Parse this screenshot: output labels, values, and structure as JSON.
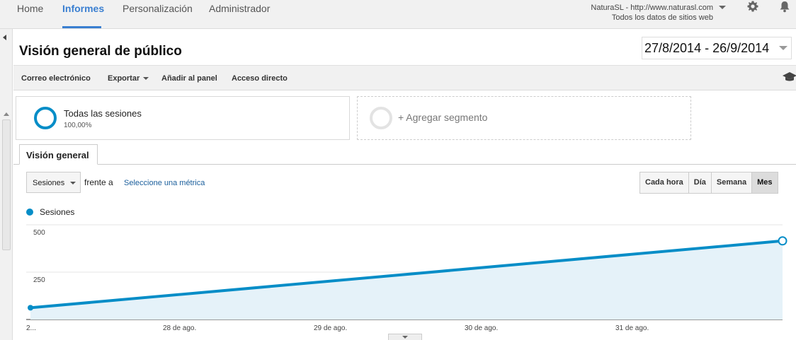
{
  "nav": {
    "tabs": [
      {
        "label": "Home"
      },
      {
        "label": "Informes"
      },
      {
        "label": "Personalización"
      },
      {
        "label": "Administrador"
      }
    ],
    "active": "Informes"
  },
  "account": {
    "property": "NaturaSL - http://www.naturasl.com",
    "view": "Todos los datos de sitios web"
  },
  "header": {
    "title": "Visión general de público",
    "date_range": "27/8/2014 - 26/9/2014"
  },
  "toolbar": {
    "email": "Correo electrónico",
    "export": "Exportar",
    "add_dashboard": "Añadir al panel",
    "shortcut": "Acceso directo"
  },
  "segment": {
    "name": "Todas las sesiones",
    "percent": "100,00%",
    "add_label": "+ Agregar segmento"
  },
  "tab": {
    "label": "Visión general"
  },
  "metric": {
    "selected": "Sesiones",
    "versus": "frente a",
    "select_link": "Seleccione una métrica"
  },
  "granularity": {
    "options": [
      "Cada hora",
      "Día",
      "Semana",
      "Mes"
    ],
    "active": "Mes"
  },
  "colors": {
    "accent": "#058dc7",
    "nav_active": "#3a7fd1",
    "fill": "#e5f2f9"
  },
  "chart_data": {
    "type": "area",
    "series": [
      {
        "name": "Sesiones",
        "x": [
          "27/8/2014",
          "26/9/2014"
        ],
        "values": [
          62,
          415
        ]
      }
    ],
    "y_ticks": [
      "500",
      "250"
    ],
    "ylim": [
      0,
      500
    ],
    "x_tick_labels": [
      "2...",
      "28 de ago.",
      "29 de ago.",
      "30 de ago.",
      "31 de ago."
    ],
    "grid": true,
    "legend": "top-left"
  }
}
